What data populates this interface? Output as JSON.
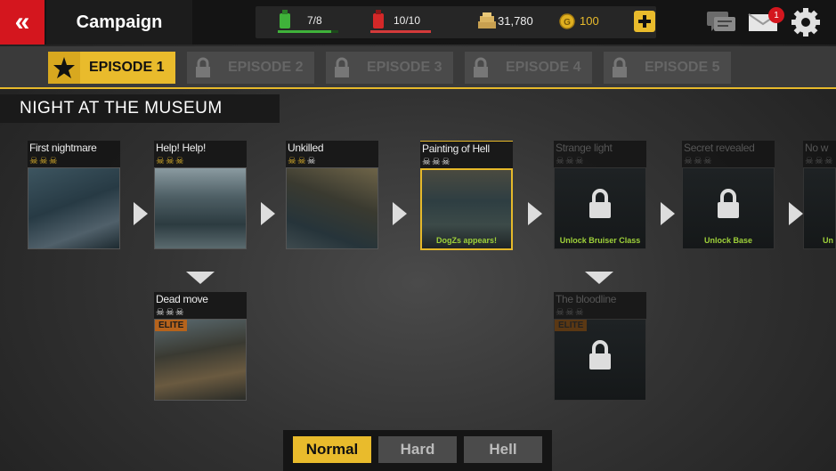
{
  "header": {
    "back_icon": "double-chevron-left-icon",
    "title": "Campaign",
    "fuel_green": "7/8",
    "fuel_red": "10/10",
    "cash": "31,780",
    "gold": "100",
    "fuel_green_fill": 0.875,
    "fuel_red_fill": 1.0,
    "mail_badge": "1",
    "icons": [
      "green-fuel-can-icon",
      "red-fuel-can-icon",
      "cash-icon",
      "gold-coin-icon",
      "plus-icon",
      "chat-icon",
      "mail-icon",
      "gear-icon"
    ]
  },
  "tabs": [
    {
      "label": "EPISODE 1",
      "active": true,
      "icon": "star-icon"
    },
    {
      "label": "EPISODE 2",
      "active": false,
      "icon": "lock-icon"
    },
    {
      "label": "EPISODE 3",
      "active": false,
      "icon": "lock-icon"
    },
    {
      "label": "EPISODE 4",
      "active": false,
      "icon": "lock-icon"
    },
    {
      "label": "EPISODE 5",
      "active": false,
      "icon": "lock-icon"
    }
  ],
  "section_title": "NIGHT AT THE MUSEUM",
  "missions": [
    {
      "name": "First nightmare",
      "skulls": "☠☠☠",
      "caption": ""
    },
    {
      "name": "Help! Help!",
      "skulls": "☠☠☠",
      "caption": ""
    },
    {
      "name": "Unkilled",
      "skulls": "☠☠☠",
      "caption": ""
    },
    {
      "name": "Painting of Hell",
      "skulls": "☠☠☠",
      "caption": "DogZs appears!"
    },
    {
      "name": "Strange light",
      "skulls": "☠☠☠",
      "caption": "Unlock Bruiser Class"
    },
    {
      "name": "Secret revealed",
      "skulls": "☠☠☠",
      "caption": "Unlock Base"
    },
    {
      "name": "No w",
      "skulls": "☠☠☠",
      "caption": "Un"
    },
    {
      "name": "Dead move",
      "skulls": "☠☠☠",
      "elite": "ELITE"
    },
    {
      "name": "The bloodline",
      "skulls": "☠☠☠",
      "elite": "ELITE"
    }
  ],
  "difficulty": [
    "Normal",
    "Hard",
    "Hell"
  ],
  "difficulty_selected": "Normal",
  "colors": {
    "accent": "#e9bb2c",
    "back": "#d4161e",
    "caption": "#9fd23a",
    "elite": "#b5631c"
  }
}
